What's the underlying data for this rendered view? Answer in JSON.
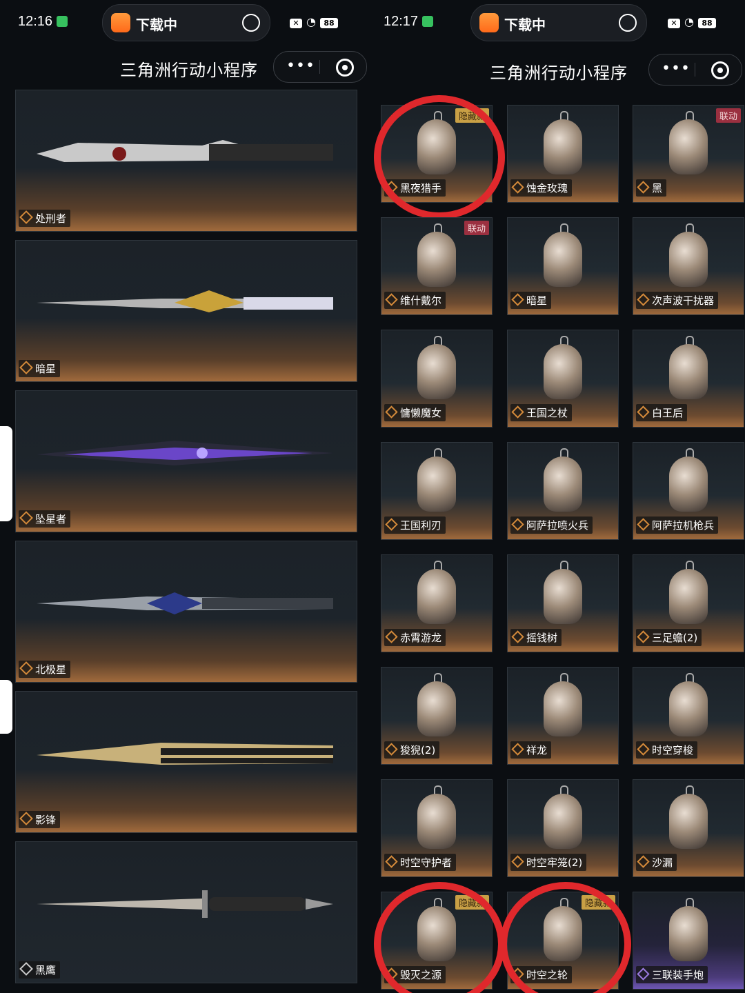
{
  "left": {
    "status": {
      "time": "12:16",
      "downloading": "下载中",
      "battery": "88"
    },
    "title": "三角洲行动小程序",
    "capsule": {
      "more": "•••"
    },
    "knives": [
      {
        "name": "处刑者"
      },
      {
        "name": "暗星"
      },
      {
        "name": "坠星者"
      },
      {
        "name": "北极星"
      },
      {
        "name": "影锋"
      },
      {
        "name": "黑鹰"
      }
    ]
  },
  "right": {
    "status": {
      "time": "12:17",
      "downloading": "下载中",
      "battery": "88"
    },
    "title": "三角洲行动小程序",
    "capsule": {
      "more": "•••"
    },
    "items": [
      {
        "name": "黑夜猎手",
        "badge": "隐藏款",
        "badge_type": "hidden",
        "circled": true
      },
      {
        "name": "蚀金玫瑰",
        "badge": "",
        "badge_type": ""
      },
      {
        "name": "黑",
        "badge": "联动",
        "badge_type": "collab"
      },
      {
        "name": "维什戴尔",
        "badge": "联动",
        "badge_type": "collab"
      },
      {
        "name": "暗星",
        "badge": "",
        "badge_type": ""
      },
      {
        "name": "次声波干扰器",
        "badge": "",
        "badge_type": ""
      },
      {
        "name": "慵懒魔女",
        "badge": "",
        "badge_type": ""
      },
      {
        "name": "王国之杖",
        "badge": "",
        "badge_type": ""
      },
      {
        "name": "白王后",
        "badge": "",
        "badge_type": ""
      },
      {
        "name": "王国利刃",
        "badge": "",
        "badge_type": ""
      },
      {
        "name": "阿萨拉喷火兵",
        "badge": "",
        "badge_type": ""
      },
      {
        "name": "阿萨拉机枪兵",
        "badge": "",
        "badge_type": ""
      },
      {
        "name": "赤霄游龙",
        "badge": "",
        "badge_type": ""
      },
      {
        "name": "摇钱树",
        "badge": "",
        "badge_type": ""
      },
      {
        "name": "三足蟾(2)",
        "badge": "",
        "badge_type": ""
      },
      {
        "name": "狻猊(2)",
        "badge": "",
        "badge_type": ""
      },
      {
        "name": "祥龙",
        "badge": "",
        "badge_type": ""
      },
      {
        "name": "时空穿梭",
        "badge": "",
        "badge_type": ""
      },
      {
        "name": "时空守护者",
        "badge": "",
        "badge_type": ""
      },
      {
        "name": "时空牢笼(2)",
        "badge": "",
        "badge_type": ""
      },
      {
        "name": "沙漏",
        "badge": "",
        "badge_type": ""
      },
      {
        "name": "毁灭之源",
        "badge": "隐藏款",
        "badge_type": "hidden",
        "circled": true
      },
      {
        "name": "时空之轮",
        "badge": "隐藏款",
        "badge_type": "hidden",
        "circled": true
      },
      {
        "name": "三联装手炮",
        "badge": "",
        "badge_type": "",
        "rarity": "purple"
      }
    ]
  },
  "colors": {
    "highlight_circle": "#e0282c",
    "hidden_badge": "#c9a045",
    "collab_badge": "#9b3040",
    "rarity_gold": "#a06a3c",
    "rarity_purple": "#6d56b3"
  }
}
